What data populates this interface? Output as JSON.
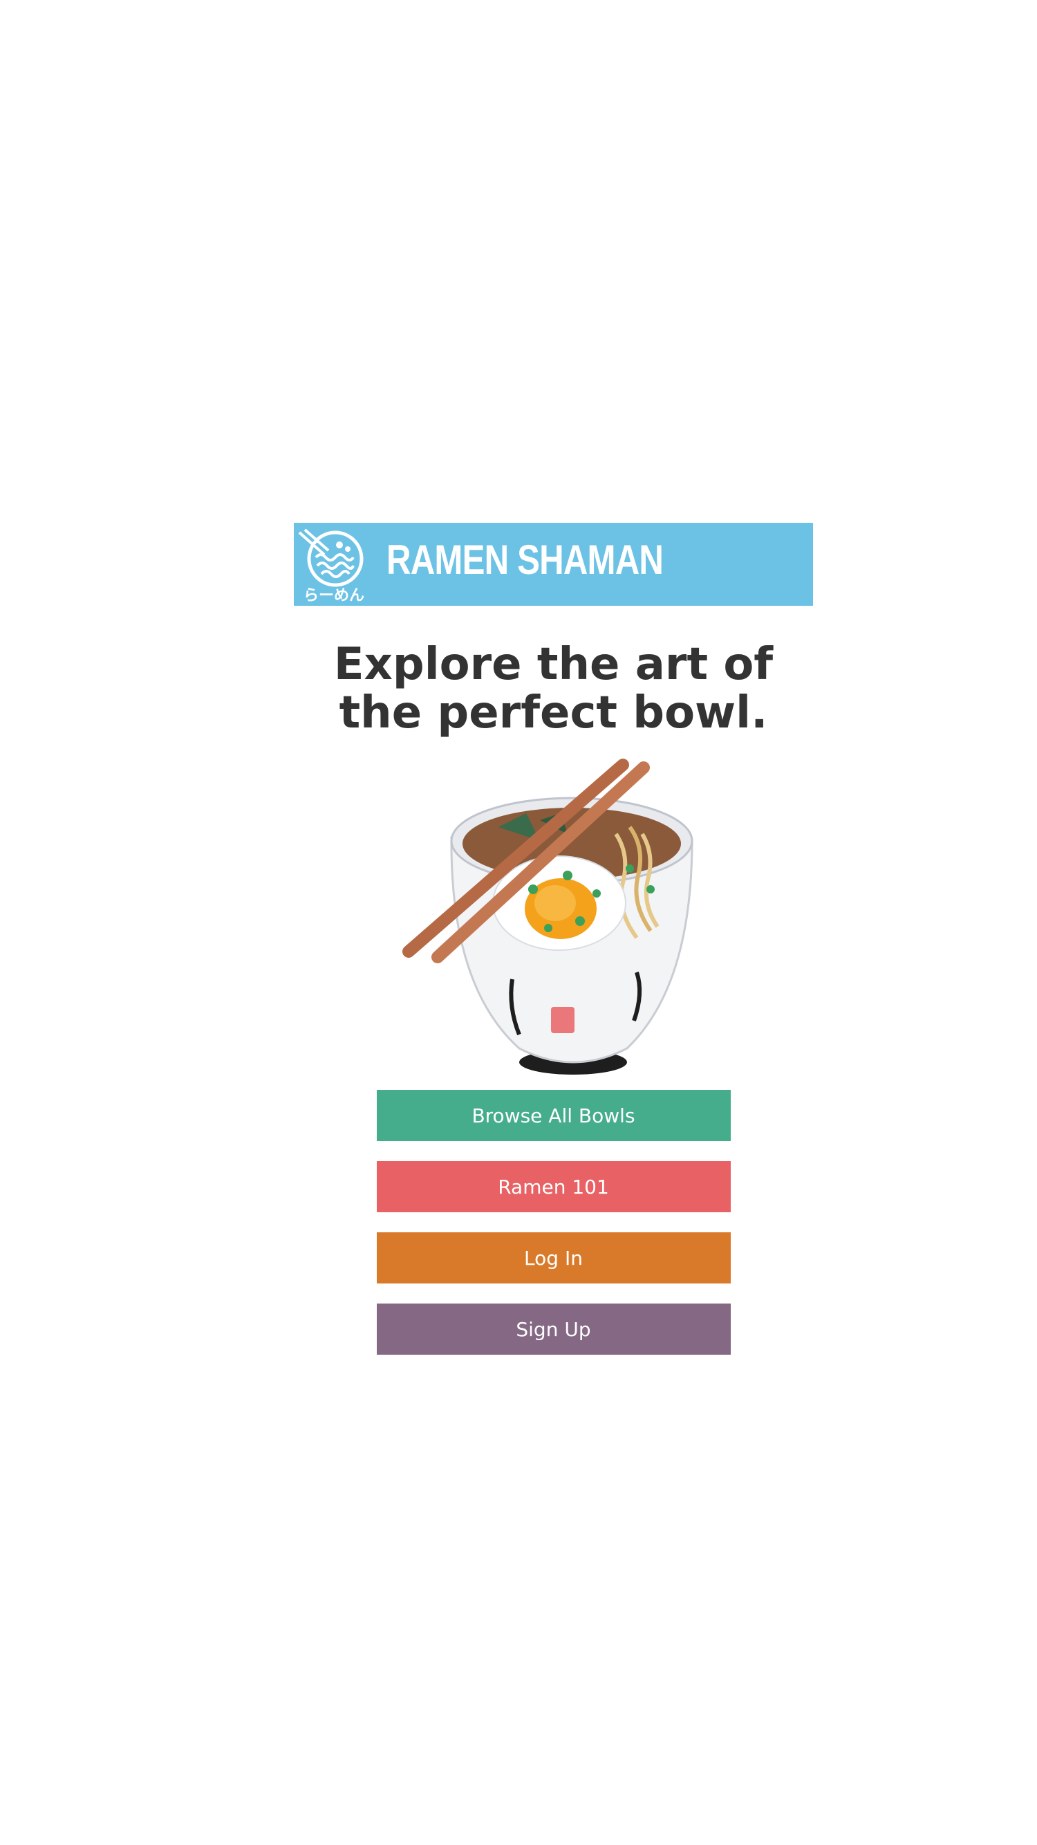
{
  "header": {
    "brand": "RAMEN SHAMAN",
    "logo_text": "らーめん",
    "background": "#6cc2e5"
  },
  "hero": {
    "headline_line1": "Explore the art of",
    "headline_line2": "the perfect bowl.",
    "image_icon": "ramen-bowl-illustration"
  },
  "buttons": [
    {
      "label": "Browse All Bowls",
      "color": "#45ad8b"
    },
    {
      "label": "Ramen 101",
      "color": "#e86164"
    },
    {
      "label": "Log In",
      "color": "#d97a2b"
    },
    {
      "label": "Sign Up",
      "color": "#846884"
    }
  ]
}
